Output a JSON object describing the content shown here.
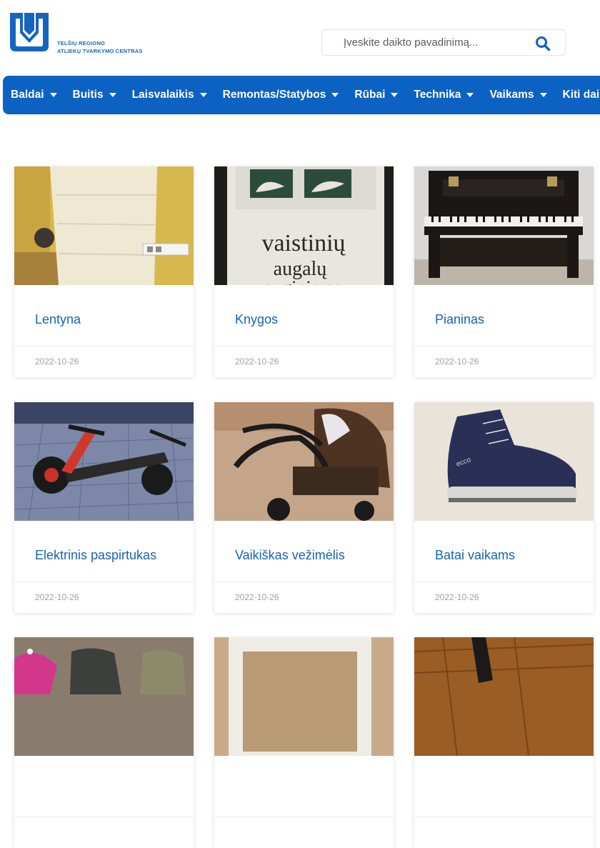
{
  "logo": {
    "line1": "TELŠIŲ REGIONO",
    "line2": "ATLIEKŲ TVARKYMO CENTRAS",
    "brand_color": "#1565c0"
  },
  "search": {
    "placeholder": "Įveskite daikto pavadinimą...",
    "value": "",
    "icon": "search-icon"
  },
  "nav": {
    "background": "#0c62c2",
    "items": [
      {
        "label": "Baldai"
      },
      {
        "label": "Buitis"
      },
      {
        "label": "Laisvalaikis"
      },
      {
        "label": "Remontas/Statybos"
      },
      {
        "label": "Rūbai"
      },
      {
        "label": "Technika"
      },
      {
        "label": "Vaikams"
      },
      {
        "label": "Kiti daiktai"
      }
    ]
  },
  "cards": [
    {
      "title": "Lentyna",
      "date": "2022-10-26",
      "image": "white-shelf-photo"
    },
    {
      "title": "Knygos",
      "date": "2022-10-26",
      "image": "books-photo"
    },
    {
      "title": "Pianinas",
      "date": "2022-10-26",
      "image": "piano-photo"
    },
    {
      "title": "Elektrinis paspirtukas",
      "date": "2022-10-26",
      "image": "electric-scooter-photo"
    },
    {
      "title": "Vaikiškas vežimėlis",
      "date": "2022-10-26",
      "image": "stroller-photo"
    },
    {
      "title": "Batai vaikams",
      "date": "2022-10-26",
      "image": "kids-shoes-photo"
    },
    {
      "title": "",
      "date": "",
      "image": "clothes-photo"
    },
    {
      "title": "",
      "date": "",
      "image": "box-photo"
    },
    {
      "title": "",
      "date": "",
      "image": "wooden-floor-photo"
    }
  ]
}
